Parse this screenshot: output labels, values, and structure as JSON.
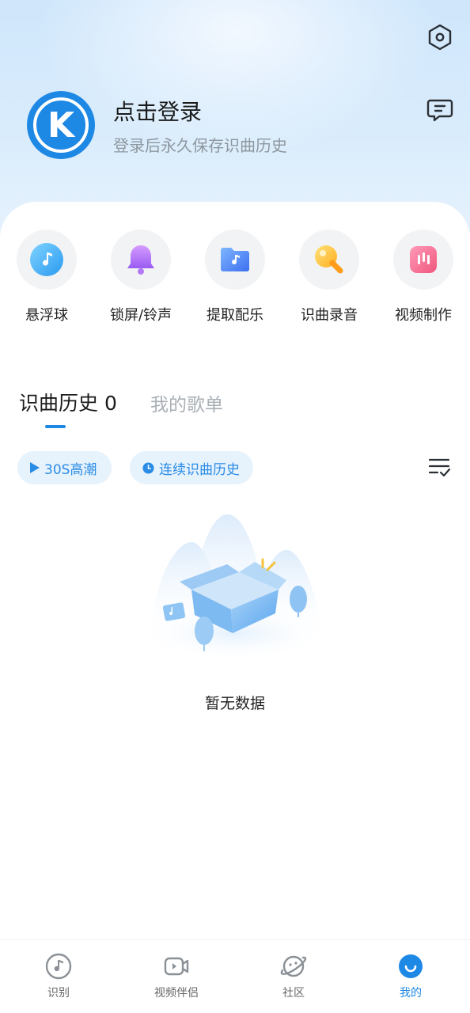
{
  "header": {
    "login_title": "点击登录",
    "login_subtitle": "登录后永久保存识曲历史",
    "logo_letter": "K"
  },
  "tools": [
    {
      "label": "悬浮球",
      "icon": "music-note-icon"
    },
    {
      "label": "锁屏/铃声",
      "icon": "bell-icon"
    },
    {
      "label": "提取配乐",
      "icon": "music-folder-icon"
    },
    {
      "label": "识曲录音",
      "icon": "record-key-icon"
    },
    {
      "label": "视频制作",
      "icon": "video-make-icon"
    }
  ],
  "tabs": {
    "history": "识曲历史",
    "history_count": "0",
    "playlist": "我的歌单"
  },
  "chips": {
    "play": "30S高潮",
    "continuous": "连续识曲历史"
  },
  "empty": {
    "text": "暂无数据"
  },
  "bottom_nav": [
    {
      "label": "识别",
      "icon": "music-note-circle-icon",
      "active": false
    },
    {
      "label": "视频伴侣",
      "icon": "video-camera-icon",
      "active": false
    },
    {
      "label": "社区",
      "icon": "planet-icon",
      "active": false
    },
    {
      "label": "我的",
      "icon": "smile-icon",
      "active": true
    }
  ],
  "colors": {
    "accent": "#1e88e5",
    "chip_bg": "#e6f2fc",
    "chip_text": "#2b8ce6"
  }
}
